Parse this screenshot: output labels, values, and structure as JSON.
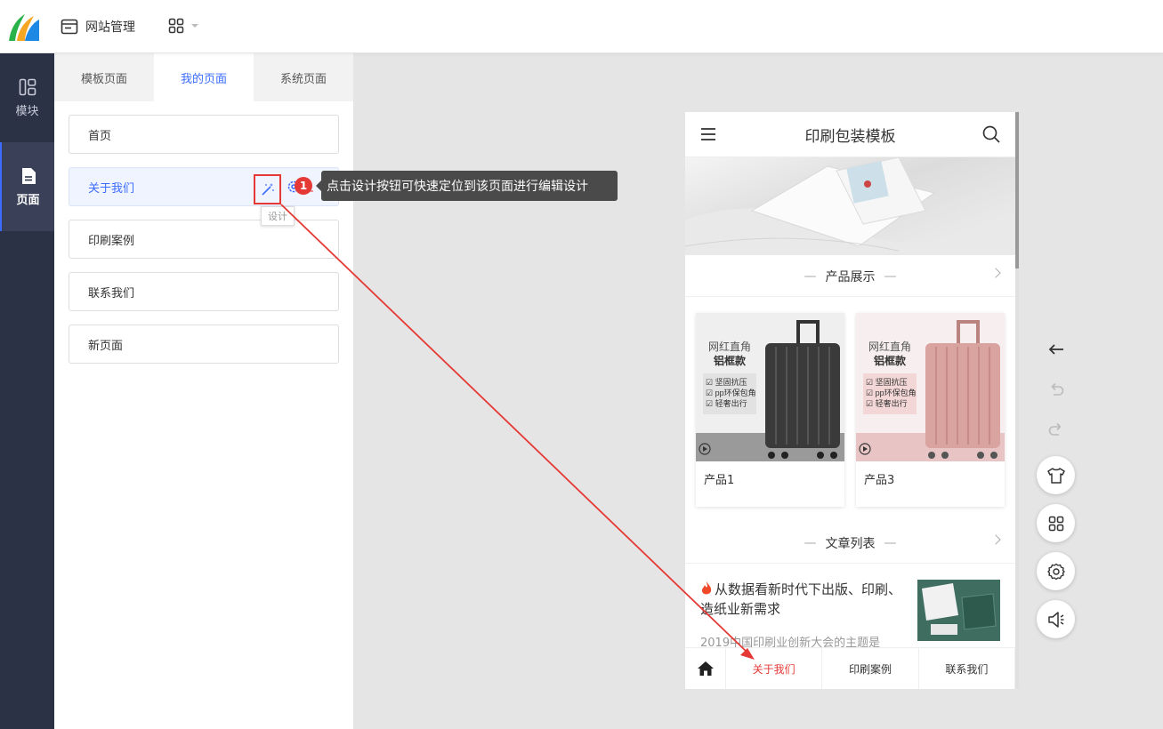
{
  "topbar": {
    "site_mgmt_label": "网站管理"
  },
  "rail": {
    "items": [
      {
        "label": "模块",
        "icon": "module-icon"
      },
      {
        "label": "页面",
        "icon": "page-icon"
      }
    ]
  },
  "panel": {
    "tabs": [
      {
        "label": "模板页面"
      },
      {
        "label": "我的页面"
      },
      {
        "label": "系统页面"
      }
    ],
    "pages": [
      {
        "label": "首页"
      },
      {
        "label": "关于我们"
      },
      {
        "label": "印刷案例"
      },
      {
        "label": "联系我们"
      },
      {
        "label": "新页面"
      }
    ],
    "design_hint": "设计"
  },
  "guide": {
    "step": "1",
    "text": "点击设计按钮可快速定位到该页面进行编辑设计"
  },
  "phone": {
    "title": "印刷包装模板",
    "sections": {
      "products": "产品展示",
      "articles": "文章列表"
    },
    "products": [
      {
        "name": "产品1",
        "headline": "网红直角",
        "sub": "铝框款",
        "features": [
          "☑ 坚固抗压",
          "☑ pp环保包角",
          "☑ 轻奢出行"
        ],
        "color": "#3a3a3a"
      },
      {
        "name": "产品3",
        "headline": "网红直角",
        "sub": "铝框款",
        "features": [
          "☑ 坚固抗压",
          "☑ pp环保包角",
          "☑ 轻奢出行"
        ],
        "color": "#d9a3a0"
      }
    ],
    "article": {
      "title": "从数据看新时代下出版、印刷、造纸业新需求",
      "desc": "2019中国印刷业创新大会的主题是"
    },
    "nav": [
      {
        "label": "关于我们"
      },
      {
        "label": "印刷案例"
      },
      {
        "label": "联系我们"
      }
    ]
  },
  "tools": [
    "back-arrow-icon",
    "undo-icon",
    "redo-icon",
    "theme-shirt-icon",
    "modules-grid-icon",
    "settings-gear-icon",
    "announcement-icon"
  ],
  "colors": {
    "accent": "#3b6cff",
    "danger": "#e53935",
    "rail_bg": "#2c3246"
  }
}
